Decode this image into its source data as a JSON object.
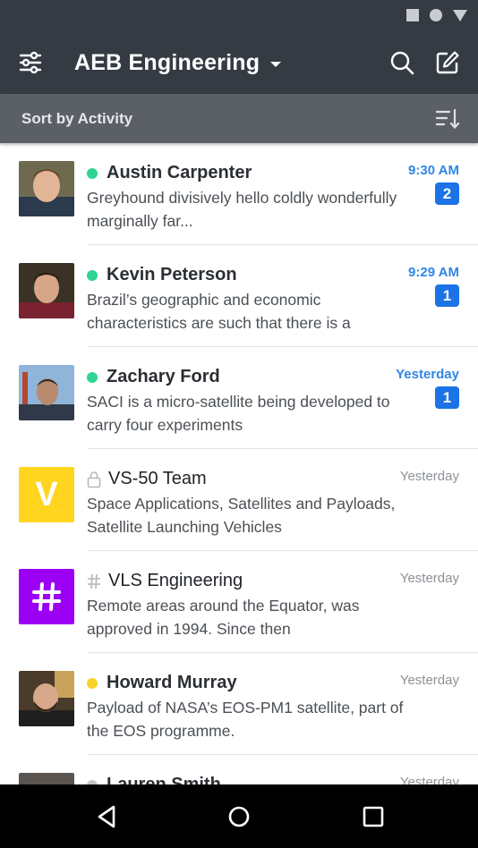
{
  "header": {
    "workspace_title": "AEB Engineering",
    "sort_label": "Sort by Activity"
  },
  "colors": {
    "appbar_bg": "#353b43",
    "sortbar_bg": "#5b6067",
    "accent_blue": "#2f86e6",
    "badge_blue": "#1b73e6",
    "online_green": "#2ed492",
    "away_yellow": "#f9d328",
    "offline_gray": "#c2c5c9",
    "channel_yellow": "#ffd51f",
    "channel_purple": "#9b00f5"
  },
  "icons": {
    "filter": "sliders-icon",
    "search": "search-icon",
    "compose": "compose-icon",
    "sort": "sort-list-icon",
    "lock": "lock-icon",
    "hash": "hash-icon"
  },
  "conversations": [
    {
      "name": "Austin Carpenter",
      "preview": "Greyhound divisively hello coldly wonderfully marginally far...",
      "time": "9:30 AM",
      "unread": "2",
      "presence": "online"
    },
    {
      "name": "Kevin Peterson",
      "preview": "Brazil’s geographic and economic characteristics are such that there is a",
      "time": "9:29 AM",
      "unread": "1",
      "presence": "online"
    },
    {
      "name": "Zachary Ford",
      "preview": "SACI is a micro-satellite being developed to carry four experiments",
      "time": "Yesterday",
      "unread": "1",
      "presence": "online"
    },
    {
      "name": "VS-50 Team",
      "avatar_letter": "V",
      "preview": "Space Applications, Satellites and Payloads, Satellite Launching Vehicles",
      "time": "Yesterday",
      "type": "private-channel"
    },
    {
      "name": "VLS Engineering",
      "preview": "Remote areas around the Equator, was approved in 1994. Since then",
      "time": "Yesterday",
      "type": "public-channel"
    },
    {
      "name": "Howard Murray",
      "preview": "Payload of NASA’s EOS-PM1 satellite, part of the EOS programme.",
      "time": "Yesterday",
      "presence": "away"
    },
    {
      "name": "Lauren Smith",
      "preview": "",
      "time": "Yesterday",
      "presence": "offline"
    }
  ],
  "navbar": {
    "back": "back-icon",
    "home": "home-icon",
    "recents": "recents-icon"
  }
}
